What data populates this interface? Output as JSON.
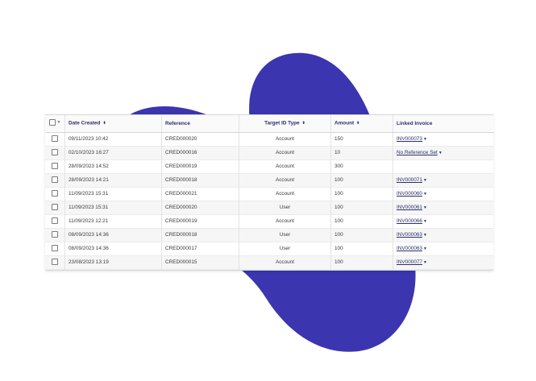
{
  "colors": {
    "blob": "#3b35b0",
    "header_text": "#2b2f6b"
  },
  "columns": {
    "date_created": "Date Created",
    "reference": "Reference",
    "target_id_type": "Target ID Type",
    "amount": "Amount",
    "linked_invoice": "Linked Invoice"
  },
  "rows": [
    {
      "date": "09/11/2023 10:42",
      "reference": "CRED000020",
      "type": "Account",
      "amount": "150",
      "linked": "INV000073"
    },
    {
      "date": "02/10/2023 16:27",
      "reference": "CRED000016",
      "type": "Account",
      "amount": "10",
      "linked": "No Reference Set"
    },
    {
      "date": "28/09/2023 14:52",
      "reference": "CRED000019",
      "type": "Account",
      "amount": "300",
      "linked": ""
    },
    {
      "date": "28/09/2023 14:21",
      "reference": "CRED000018",
      "type": "Account",
      "amount": "100",
      "linked": "INV000071"
    },
    {
      "date": "11/09/2023 15:31",
      "reference": "CRED000021",
      "type": "Account",
      "amount": "100",
      "linked": "INV000060"
    },
    {
      "date": "11/09/2023 15:31",
      "reference": "CRED000020",
      "type": "User",
      "amount": "100",
      "linked": "INV000061"
    },
    {
      "date": "11/09/2023 12:21",
      "reference": "CRED000019",
      "type": "Account",
      "amount": "100",
      "linked": "INV000066"
    },
    {
      "date": "08/09/2023 14:36",
      "reference": "CRED000018",
      "type": "User",
      "amount": "100",
      "linked": "INV000063"
    },
    {
      "date": "08/09/2023 14:36",
      "reference": "CRED000017",
      "type": "User",
      "amount": "100",
      "linked": "INV000063"
    },
    {
      "date": "23/08/2023 13:19",
      "reference": "CRED000015",
      "type": "Account",
      "amount": "100",
      "linked": "INV000077"
    }
  ]
}
